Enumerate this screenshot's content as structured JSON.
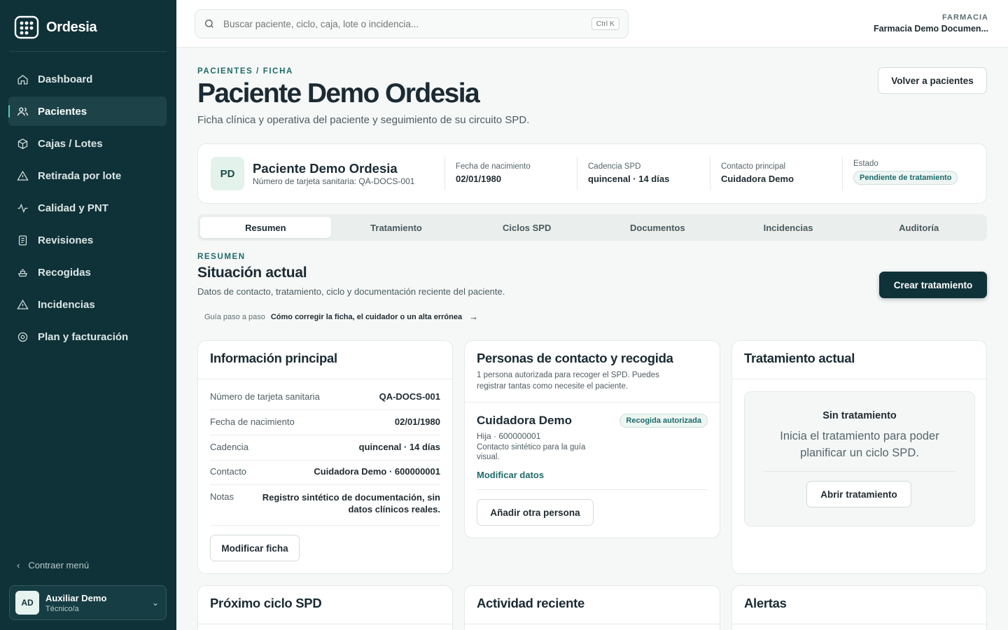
{
  "app": {
    "name": "Ordesia"
  },
  "sidebar": {
    "items": [
      {
        "label": "Dashboard",
        "icon": "home-icon"
      },
      {
        "label": "Pacientes",
        "icon": "users-icon",
        "active": true
      },
      {
        "label": "Cajas / Lotes",
        "icon": "box-icon"
      },
      {
        "label": "Retirada por lote",
        "icon": "warning-icon"
      },
      {
        "label": "Calidad y PNT",
        "icon": "activity-icon"
      },
      {
        "label": "Revisiones",
        "icon": "clipboard-icon"
      },
      {
        "label": "Recogidas",
        "icon": "pickup-icon"
      },
      {
        "label": "Incidencias",
        "icon": "warning-icon"
      },
      {
        "label": "Plan y facturación",
        "icon": "gear-icon"
      }
    ],
    "collapse_label": "Contraer menú",
    "user": {
      "initials": "AD",
      "name": "Auxiliar Demo",
      "role": "Técnico/a"
    }
  },
  "topbar": {
    "search_placeholder": "Buscar paciente, ciclo, caja, lote o incidencia...",
    "shortcut": "Ctrl K",
    "pharmacy_label": "FARMACIA",
    "pharmacy_name": "Farmacia Demo Documen..."
  },
  "page": {
    "breadcrumb": "PACIENTES / FICHA",
    "title": "Paciente Demo Ordesia",
    "subtitle": "Ficha clínica y operativa del paciente y seguimiento de su circuito SPD.",
    "back_button": "Volver a pacientes"
  },
  "patient": {
    "initials": "PD",
    "name": "Paciente Demo Ordesia",
    "card_number": "Número de tarjeta sanitaria: QA-DOCS-001",
    "fields": [
      {
        "label": "Fecha de nacimiento",
        "value": "02/01/1980"
      },
      {
        "label": "Cadencia SPD",
        "value": "quincenal · 14 días"
      },
      {
        "label": "Contacto principal",
        "value": "Cuidadora Demo"
      }
    ],
    "status_label": "Estado",
    "status_value": "Pendiente de tratamiento"
  },
  "tabs": [
    "Resumen",
    "Tratamiento",
    "Ciclos SPD",
    "Documentos",
    "Incidencias",
    "Auditoría"
  ],
  "summary": {
    "label": "RESUMEN",
    "title": "Situación actual",
    "subtitle": "Datos de contacto, tratamiento, ciclo y documentación reciente del paciente.",
    "create_button": "Crear tratamiento",
    "guide_prefix": "Guía paso a paso",
    "guide_link": "Cómo corregir la ficha, el cuidador o un alta errónea"
  },
  "info_card": {
    "title": "Información principal",
    "rows": [
      {
        "k": "Número de tarjeta sanitaria",
        "v": "QA-DOCS-001"
      },
      {
        "k": "Fecha de nacimiento",
        "v": "02/01/1980"
      },
      {
        "k": "Cadencia",
        "v": "quincenal · 14 días"
      },
      {
        "k": "Contacto",
        "v": "Cuidadora Demo · 600000001"
      },
      {
        "k": "Notas",
        "v": "Registro sintético de documentación, sin datos clínicos reales."
      }
    ],
    "button": "Modificar ficha"
  },
  "contacts_card": {
    "title": "Personas de contacto y recogida",
    "subtitle": "1 persona autorizada para recoger el SPD. Puedes registrar tantas como necesite el paciente.",
    "person": {
      "name": "Cuidadora Demo",
      "badge": "Recogida autorizada",
      "relation": "Hija · 600000001",
      "note": "Contacto sintético para la guía visual.",
      "edit_link": "Modificar datos"
    },
    "add_button": "Añadir otra persona"
  },
  "treatment_card": {
    "title": "Tratamiento actual",
    "empty_title": "Sin tratamiento",
    "empty_text": "Inicia el tratamiento para poder planificar un ciclo SPD.",
    "button": "Abrir tratamiento"
  },
  "bottom_cards": [
    "Próximo ciclo SPD",
    "Actividad reciente",
    "Alertas"
  ],
  "colors": {
    "sidebar": "#0f3138",
    "accent": "#1d6b6a",
    "active_marker": "#5cc9a7"
  }
}
